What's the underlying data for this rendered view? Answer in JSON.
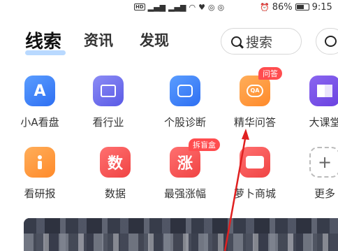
{
  "status_bar": {
    "hd": "HD",
    "battery": "86%",
    "time": "9:15"
  },
  "nav": {
    "tabs": [
      {
        "label": "线索",
        "active": true
      },
      {
        "label": "资讯",
        "active": false
      },
      {
        "label": "发现",
        "active": false
      }
    ],
    "search_label": "搜索"
  },
  "grid": {
    "row1": [
      {
        "label": "小A看盘",
        "glyph": "A",
        "icon": "a-icon",
        "color": "#3d82f7"
      },
      {
        "label": "看行业",
        "glyph": "",
        "icon": "chart-board-icon",
        "color": "#6c6cee"
      },
      {
        "label": "个股诊断",
        "glyph": "",
        "icon": "stock-diagnosis-icon",
        "color": "#3d82f7"
      },
      {
        "label": "精华问答",
        "glyph": "QA",
        "icon": "qa-bubble-icon",
        "color": "#ff9a40",
        "badge": "问答"
      },
      {
        "label": "大课堂",
        "glyph": "",
        "icon": "book-icon",
        "color": "#7a52e8"
      }
    ],
    "row2": [
      {
        "label": "看研报",
        "glyph": "i",
        "icon": "info-icon",
        "color": "#ff9a40"
      },
      {
        "label": "数据",
        "glyph": "数",
        "icon": "data-icon",
        "color": "#f45a5a"
      },
      {
        "label": "最强涨幅",
        "glyph": "涨",
        "icon": "rise-icon",
        "color": "#f45a5a",
        "badge": "拆盲盒"
      },
      {
        "label": "萝卜商城",
        "glyph": "",
        "icon": "store-icon",
        "color": "#f45a5a"
      },
      {
        "label": "更多",
        "glyph": "+",
        "icon": "plus-icon",
        "color": "#bbbbbb"
      }
    ]
  }
}
